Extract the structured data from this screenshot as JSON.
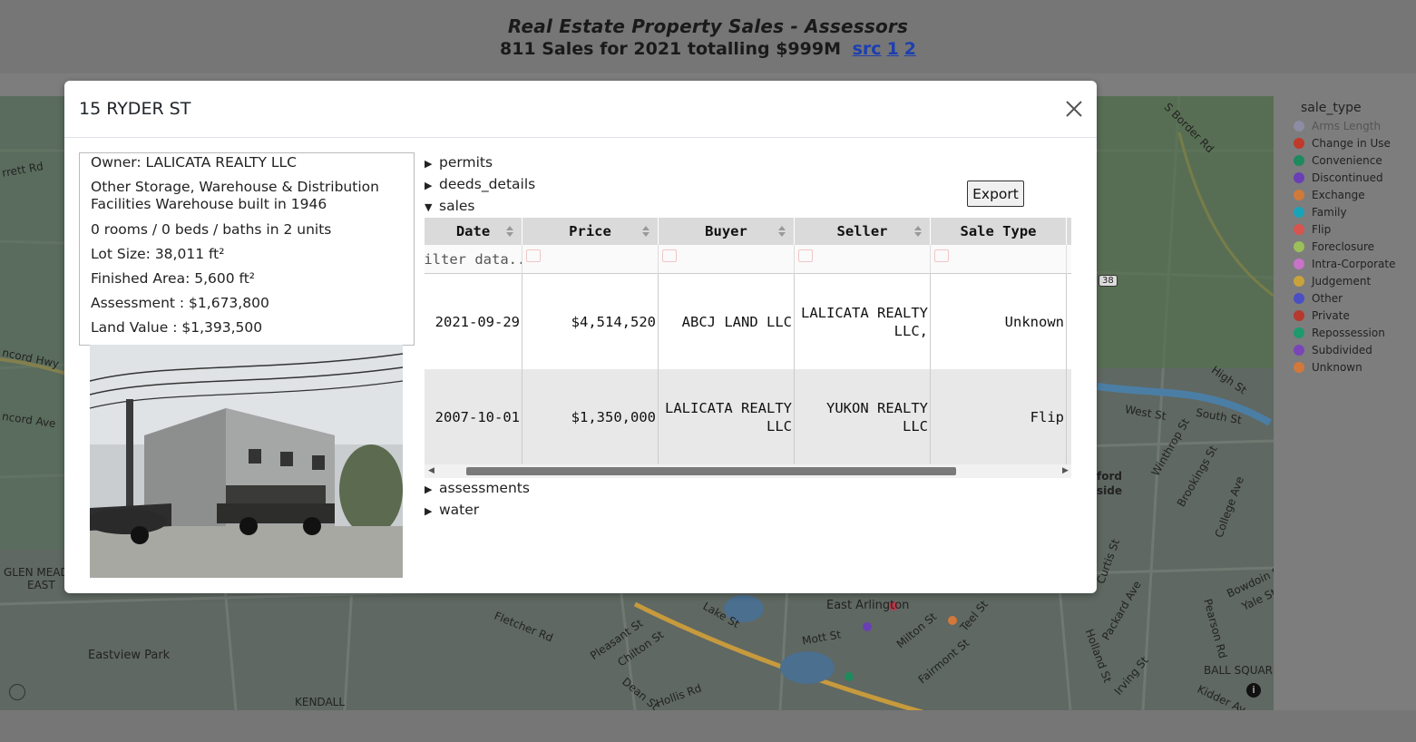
{
  "header": {
    "title": "Real Estate Property Sales - Assessors",
    "subtitle": "811 Sales for 2021 totalling $999M",
    "links": [
      "src",
      "1",
      "2"
    ]
  },
  "map": {
    "labels": [
      "rrett Rd",
      "ncord Hwy",
      "ncord Ave",
      "GLEN MEADOW",
      "EAST",
      "Eastview Park",
      "KENDALL",
      "Fletcher Rd",
      "Pleasant St",
      "Chilton St",
      "Lake St",
      "Dean St",
      "Hollis Rd",
      "Mott St",
      "Milton St",
      "Teel St",
      "East Arlington",
      "Fairmont St",
      "Holland St",
      "Irving St",
      "Packard Ave",
      "Pearson Rd",
      "BALL SQUARE",
      "Kidder Av",
      "S Border Rd",
      "High St",
      "West St",
      "South St",
      "Winthrop St",
      "Brookings St",
      "College Ave",
      "Curtis St",
      "Bowdoin St",
      "Yale St",
      "ford",
      "side",
      "38"
    ]
  },
  "legend": {
    "title": "sale_type",
    "items": [
      {
        "label": "Arms Length",
        "color": "#9b9bc9",
        "dim": true
      },
      {
        "label": "Change in Use",
        "color": "#c0392b"
      },
      {
        "label": "Convenience",
        "color": "#1e8a5e"
      },
      {
        "label": "Discontinued",
        "color": "#6a3fb5"
      },
      {
        "label": "Exchange",
        "color": "#d07a3a"
      },
      {
        "label": "Family",
        "color": "#1aa3b8"
      },
      {
        "label": "Flip",
        "color": "#d9534f"
      },
      {
        "label": "Foreclosure",
        "color": "#9bbf5a"
      },
      {
        "label": "Intra-Corporate",
        "color": "#c873c8"
      },
      {
        "label": "Judgement",
        "color": "#c9a23a"
      },
      {
        "label": "Other",
        "color": "#4a4fc4"
      },
      {
        "label": "Private",
        "color": "#b5392e"
      },
      {
        "label": "Repossession",
        "color": "#1e9a6e"
      },
      {
        "label": "Subdivided",
        "color": "#7a45b8"
      },
      {
        "label": "Unknown",
        "color": "#d2783a"
      }
    ]
  },
  "modal": {
    "title": "15 RYDER ST",
    "info": {
      "owner": "Owner: LALICATA REALTY LLC",
      "use_line1": "Other Storage, Warehouse & Distribution",
      "use_line2": "Facilities Warehouse built in 1946",
      "rooms": "0 rooms / 0 beds / baths in 2 units",
      "lot": "Lot Size: 38,011 ft²",
      "finished": "Finished Area: 5,600 ft²",
      "assessment": "Assessment : $1,673,800",
      "land": "Land Value : $1,393,500"
    },
    "sections": {
      "permits": "permits",
      "deeds": "deeds_details",
      "sales": "sales",
      "assessments": "assessments",
      "water": "water"
    },
    "export_label": "Export",
    "table": {
      "columns": [
        "Date",
        "Price",
        "Buyer",
        "Seller",
        "Sale Type"
      ],
      "filter_placeholder": "Filter data...",
      "rows": [
        [
          "2021-09-29",
          "$4,514,520",
          "ABCJ LAND LLC",
          "LALICATA REALTY\nLLC,",
          "Unknown"
        ],
        [
          "2007-10-01",
          "$1,350,000",
          "LALICATA REALTY\nLLC",
          "YUKON REALTY\nLLC",
          "Flip"
        ]
      ]
    }
  }
}
